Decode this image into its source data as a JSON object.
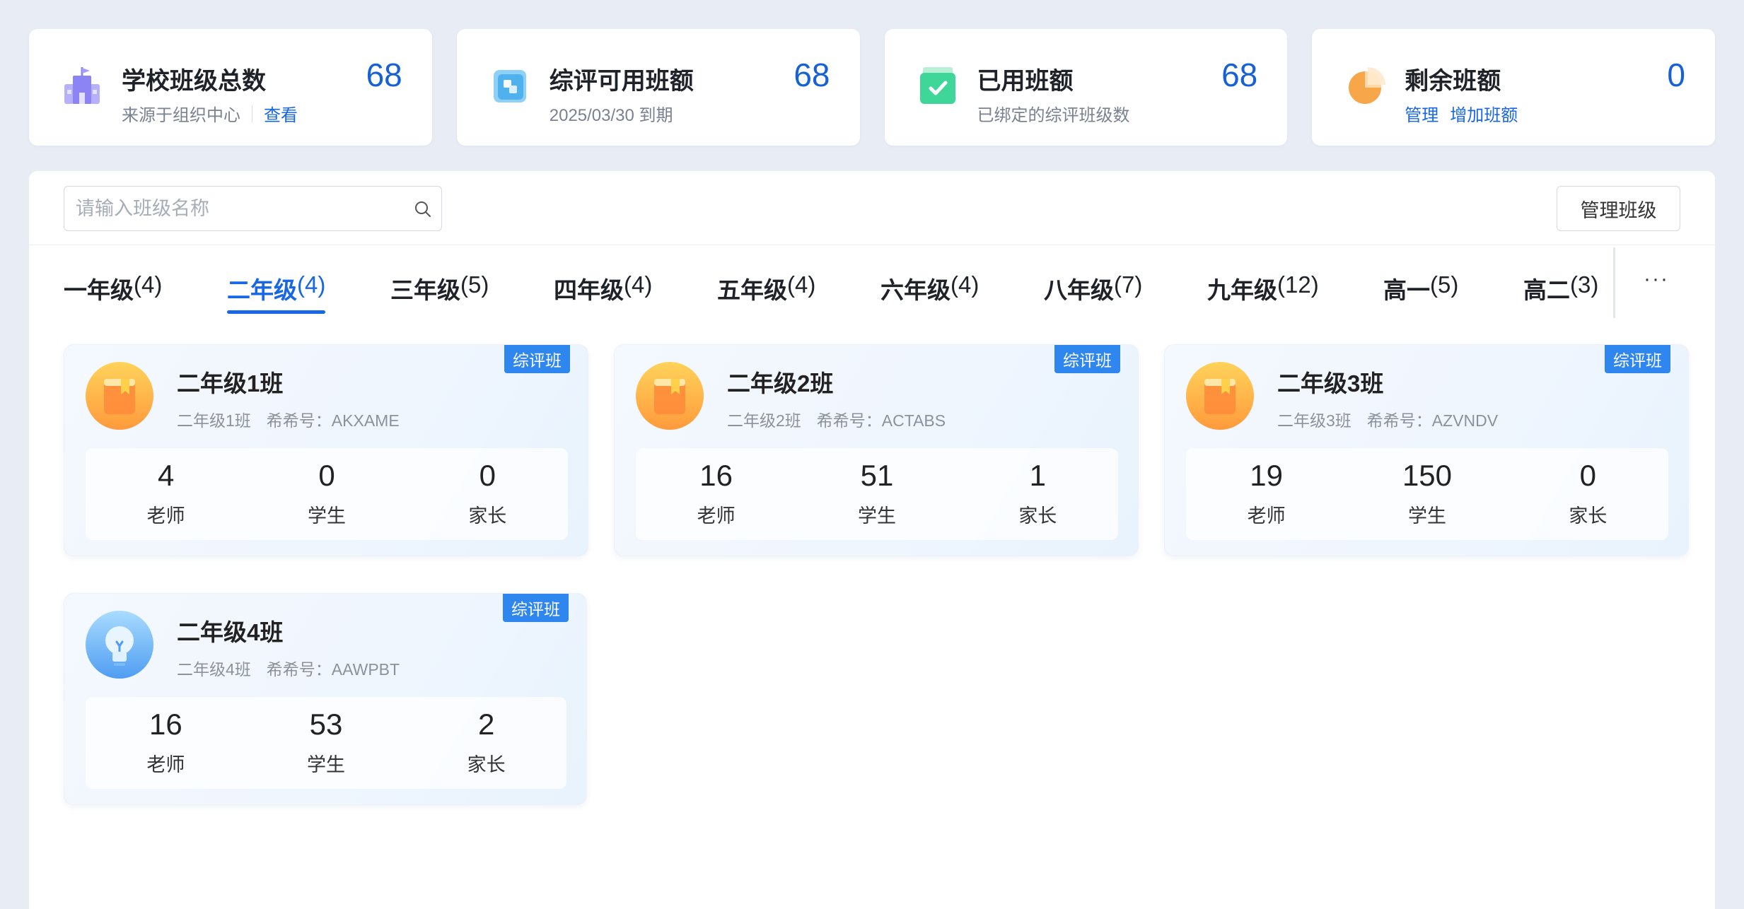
{
  "stats": [
    {
      "title": "学校班级总数",
      "sub_text": "来源于组织中心",
      "links": [
        "查看"
      ],
      "value": "68",
      "icon": "school-icon",
      "color": "#8c83f5"
    },
    {
      "title": "综评可用班额",
      "sub_text": "2025/03/30 到期",
      "links": [],
      "value": "68",
      "icon": "cube-icon",
      "color": "#4fb2ee"
    },
    {
      "title": "已用班额",
      "sub_text": "已绑定的综评班级数",
      "links": [],
      "value": "68",
      "icon": "check-folder-icon",
      "color": "#3fd69a"
    },
    {
      "title": "剩余班额",
      "sub_text": "",
      "links": [
        "管理",
        "增加班额"
      ],
      "value": "0",
      "icon": "pie-icon",
      "color": "#f7a64a"
    }
  ],
  "search": {
    "placeholder": "请输入班级名称"
  },
  "manage_button": "管理班级",
  "tabs": [
    {
      "name": "一年级",
      "count": "(4)",
      "active": false
    },
    {
      "name": "二年级",
      "count": "(4)",
      "active": true
    },
    {
      "name": "三年级",
      "count": "(5)",
      "active": false
    },
    {
      "name": "四年级",
      "count": "(4)",
      "active": false
    },
    {
      "name": "五年级",
      "count": "(4)",
      "active": false
    },
    {
      "name": "六年级",
      "count": "(4)",
      "active": false
    },
    {
      "name": "八年级",
      "count": "(7)",
      "active": false
    },
    {
      "name": "九年级",
      "count": "(12)",
      "active": false
    },
    {
      "name": "高一",
      "count": "(5)",
      "active": false
    },
    {
      "name": "高二",
      "count": "(3)",
      "active": false
    }
  ],
  "tabs_more": "···",
  "classes": [
    {
      "name": "二年级1班",
      "sub_name": "二年级1班",
      "code": "希希号：AKXAME",
      "badge": "综评班",
      "avatar": "book-icon",
      "teachers": "4",
      "students": "0",
      "parents": "0"
    },
    {
      "name": "二年级2班",
      "sub_name": "二年级2班",
      "code": "希希号：ACTABS",
      "badge": "综评班",
      "avatar": "book-icon",
      "teachers": "16",
      "students": "51",
      "parents": "1"
    },
    {
      "name": "二年级3班",
      "sub_name": "二年级3班",
      "code": "希希号：AZVNDV",
      "badge": "综评班",
      "avatar": "book-icon",
      "teachers": "19",
      "students": "150",
      "parents": "0"
    },
    {
      "name": "二年级4班",
      "sub_name": "二年级4班",
      "code": "希希号：AAWPBT",
      "badge": "综评班",
      "avatar": "lightbulb-icon",
      "teachers": "16",
      "students": "53",
      "parents": "2"
    }
  ],
  "labels": {
    "teachers": "老师",
    "students": "学生",
    "parents": "家长"
  }
}
